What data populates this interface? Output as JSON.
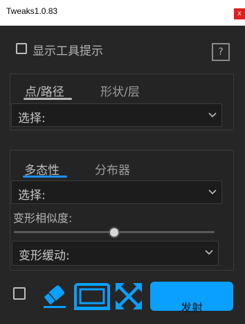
{
  "window": {
    "title": "Tweaks1.0.83",
    "close": "x"
  },
  "show_tooltips": {
    "label": "显示工具提示",
    "checked": false
  },
  "help": {
    "label": "?"
  },
  "path_panel": {
    "tabs": [
      {
        "label": "点/路径",
        "active": true
      },
      {
        "label": "形状/层",
        "active": false
      }
    ],
    "select": {
      "value": "选择:"
    }
  },
  "morph_panel": {
    "tabs": [
      {
        "label": "多态性",
        "active": true
      },
      {
        "label": "分布器",
        "active": false
      }
    ],
    "select": {
      "value": "选择:"
    },
    "similarity": {
      "label": "变形相似度:",
      "value": 0.5
    },
    "easing": {
      "value": "变形缓动:"
    }
  },
  "footer": {
    "checkbox_checked": false,
    "fire_label": "发射",
    "accent_color": "#0aa0ff",
    "icons": [
      "eraser-icon",
      "screen-frame-icon",
      "expand-arrows-icon"
    ]
  }
}
